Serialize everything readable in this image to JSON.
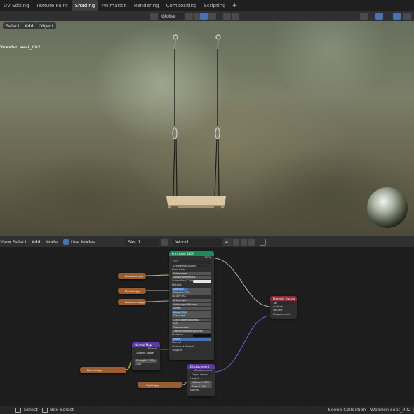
{
  "tabs": {
    "items": [
      "UV Editing",
      "Texture Paint",
      "Shading",
      "Animation",
      "Rendering",
      "Compositing",
      "Scripting"
    ],
    "active": "Shading",
    "add_label": "+"
  },
  "viewport_header": {
    "orientation": "Global"
  },
  "viewport": {
    "menu": [
      "Select",
      "Add",
      "Object"
    ],
    "object_label": "Wooden seat_002"
  },
  "node_header": {
    "menu": [
      "View",
      "Select",
      "Add",
      "Node"
    ],
    "use_nodes_label": "Use Nodes",
    "use_nodes_checked": true,
    "slot": "Slot 1",
    "material": "Wood",
    "users": "4"
  },
  "nodes": {
    "principled": {
      "title": "Principled BSDF",
      "output": "BSDF",
      "distribution": "GGX",
      "subsurface_method": "Christensen-Burley",
      "rows": [
        "Base Color",
        "Subsurface",
        "Subsurface Radius",
        "Subsurface Color",
        "Metallic",
        "Specular",
        "Specular Tint",
        "Roughness",
        "Anisotropic",
        "Anisotropic Rotation",
        "Sheen",
        "Sheen Tint",
        "Clearcoat",
        "Clearcoat Roughness",
        "IOR",
        "Transmission",
        "Transmission Roughness",
        "Emission",
        "Alpha",
        "Normal",
        "Clearcoat Normal",
        "Tangent"
      ],
      "values": {
        "Subsurface": "0.000",
        "Metallic": "0.000",
        "Specular": "0.500",
        "Specular Tint": "0.000",
        "Anisotropic": "0.000",
        "Anisotropic Rotation": "0.000",
        "Sheen": "0.000",
        "Sheen Tint": "0.500",
        "Clearcoat": "0.000",
        "Clearcoat Roughness": "0.030",
        "IOR": "1.450",
        "Transmission": "0.000",
        "Transmission Roughness": "0.000",
        "Alpha": "1.000"
      }
    },
    "material_output": {
      "title": "Material Output",
      "target": "All",
      "rows": [
        "Surface",
        "Volume",
        "Displacement"
      ]
    },
    "normal_map": {
      "title": "Normal Map",
      "output": "Normal",
      "space": "Tangent Space",
      "strength_label": "Strength",
      "strength": "1.000",
      "color_label": "Color"
    },
    "displacement": {
      "title": "Displacement",
      "output": "Displacement",
      "space": "Object Space",
      "rows": [
        "Height",
        "Midlevel",
        "Scale",
        "Normal"
      ],
      "midlevel": "0.500",
      "scale": "1.000"
    },
    "image_textures": [
      "BaseColor.jpg",
      "Metallic.jpg",
      "Roughness.jpg",
      "Normal.jpg",
      "Height.jpg"
    ]
  },
  "status": {
    "left": [
      "Select",
      "Box Select"
    ],
    "right": "Scene Collection | Wooden seat_002 |"
  },
  "colors": {
    "accent": "#4772b3",
    "principled_header": "#1e8a5a",
    "output_header": "#8a2a36",
    "vector_header": "#5e3a9e",
    "image_node": "#9b5c2f",
    "link": "#a9a9a9",
    "link_vector": "#6f5cd6",
    "link_color": "#c7c729"
  }
}
